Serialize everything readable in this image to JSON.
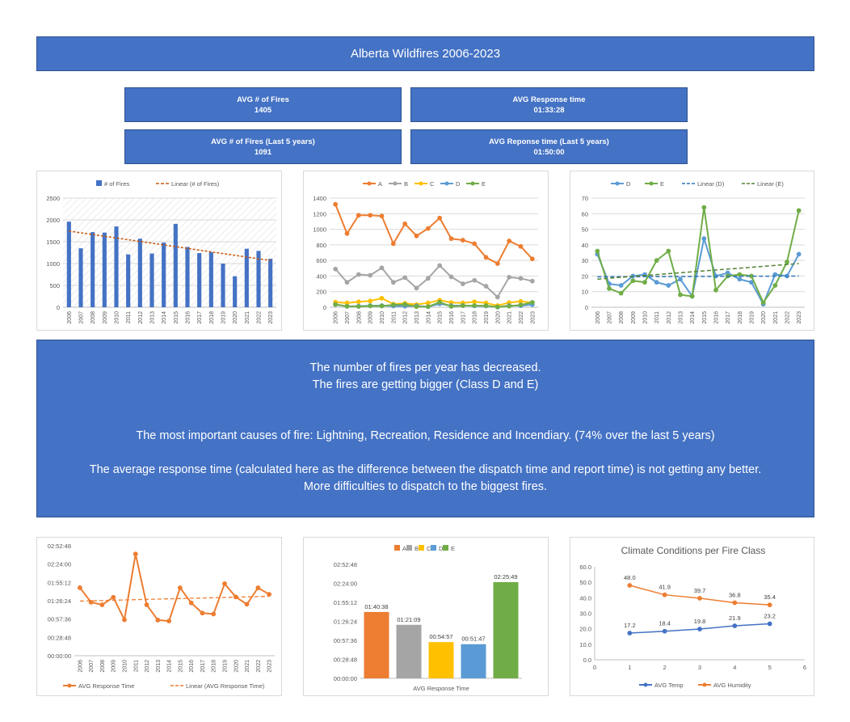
{
  "title": "Alberta Wildfires 2006-2023",
  "kpis": [
    {
      "label": "AVG # of Fires",
      "value": "1405"
    },
    {
      "label": "AVG Response time",
      "value": "01:33:28"
    },
    {
      "label": "AVG # of Fires (Last 5 years)",
      "value": "1091"
    },
    {
      "label": "AVG Reponse time (Last 5 years)",
      "value": "01:50:00"
    }
  ],
  "summary": {
    "line1": "The number of fires per year has decreased.",
    "line2": "The fires are getting bigger (Class D and E)",
    "line3": "The most important causes of fire: Lightning, Recreation, Residence and Incendiary. (74% over the last 5 years)",
    "line4": "The average response time (calculated here as the difference between the dispatch time and report time) is not getting any better.",
    "line5": "More difficulties to dispatch to the biggest fires."
  },
  "colors": {
    "blue": "#4472C4",
    "orange": "#ED7D31",
    "gray": "#A5A5A5",
    "yellow": "#FFC000",
    "lightblue": "#5B9BD5",
    "green": "#70AD47",
    "darkgreen": "#548235"
  },
  "chart_data": [
    {
      "id": "fires",
      "type": "bar",
      "categories": [
        "2006",
        "2007",
        "2008",
        "2009",
        "2010",
        "2011",
        "2012",
        "2013",
        "2014",
        "2015",
        "2016",
        "2017",
        "2018",
        "2019",
        "2020",
        "2021",
        "2022",
        "2023"
      ],
      "series": [
        {
          "name": "# of Fires",
          "values": [
            1960,
            1350,
            1720,
            1710,
            1850,
            1210,
            1570,
            1230,
            1480,
            1910,
            1380,
            1240,
            1260,
            1000,
            710,
            1340,
            1290,
            1110
          ]
        }
      ],
      "trendline": {
        "name": "Linear (# of Fires)",
        "from": 1745,
        "to": 1070
      },
      "ylim": [
        0,
        2500
      ],
      "yticks": [
        "0",
        "500",
        "1000",
        "1500",
        "2000",
        "2500"
      ],
      "legend": "top"
    },
    {
      "id": "classes",
      "type": "line",
      "categories": [
        "2006",
        "2007",
        "2008",
        "2009",
        "2010",
        "2011",
        "2012",
        "2013",
        "2014",
        "2015",
        "2016",
        "2017",
        "2018",
        "2019",
        "2020",
        "2021",
        "2022",
        "2023"
      ],
      "series": [
        {
          "name": "A",
          "values": [
            1320,
            945,
            1180,
            1180,
            1170,
            815,
            1070,
            915,
            1010,
            1145,
            880,
            860,
            815,
            640,
            560,
            850,
            780,
            620
          ]
        },
        {
          "name": "B",
          "values": [
            490,
            320,
            420,
            410,
            505,
            320,
            380,
            245,
            370,
            535,
            390,
            300,
            345,
            270,
            130,
            385,
            370,
            335
          ]
        },
        {
          "name": "C",
          "values": [
            65,
            55,
            70,
            80,
            115,
            40,
            50,
            35,
            55,
            90,
            60,
            55,
            70,
            55,
            20,
            60,
            75,
            60
          ]
        },
        {
          "name": "D",
          "values": [
            34,
            12,
            14,
            20,
            21,
            16,
            14,
            18,
            7,
            44,
            20,
            22,
            18,
            16,
            2,
            21,
            20,
            34
          ]
        },
        {
          "name": "E",
          "values": [
            36,
            12,
            9,
            17,
            16,
            30,
            36,
            8,
            7,
            64,
            11,
            20,
            21,
            20,
            3,
            14,
            29,
            62
          ]
        }
      ],
      "ylim": [
        0,
        1400
      ],
      "yticks": [
        "0",
        "200",
        "400",
        "600",
        "800",
        "1000",
        "1200",
        "1400"
      ],
      "legend": "top"
    },
    {
      "id": "de",
      "type": "line",
      "categories": [
        "2006",
        "2007",
        "2008",
        "2009",
        "2010",
        "2011",
        "2012",
        "2013",
        "2014",
        "2015",
        "2016",
        "2017",
        "2018",
        "2019",
        "2020",
        "2021",
        "2022",
        "2023"
      ],
      "series": [
        {
          "name": "D",
          "values": [
            34,
            15,
            14,
            20,
            21,
            16,
            14,
            18,
            7,
            44,
            20,
            22,
            18,
            16,
            2,
            21,
            20,
            34
          ]
        },
        {
          "name": "E",
          "values": [
            36,
            12,
            9,
            17,
            16,
            30,
            36,
            8,
            7,
            64,
            11,
            20,
            21,
            20,
            3,
            14,
            29,
            62
          ]
        }
      ],
      "trendlines": [
        {
          "name": "Linear (D)",
          "from": 19.5,
          "to": 20
        },
        {
          "name": "Linear (E)",
          "from": 18,
          "to": 28
        }
      ],
      "ylim": [
        0,
        70
      ],
      "yticks": [
        "0",
        "10",
        "20",
        "30",
        "40",
        "50",
        "60",
        "70"
      ],
      "legend": "top"
    },
    {
      "id": "response",
      "type": "line",
      "categories": [
        "2006",
        "2007",
        "2008",
        "2009",
        "2010",
        "2011",
        "2012",
        "2013",
        "2014",
        "2015",
        "2016",
        "2017",
        "2018",
        "2019",
        "2020",
        "2021",
        "2022",
        "2023"
      ],
      "series": [
        {
          "name": "AVG Response Time",
          "values": [
            6410,
            5040,
            4800,
            5510,
            3390,
            9590,
            4800,
            3360,
            3270,
            6400,
            4980,
            4020,
            3930,
            6790,
            5540,
            4850,
            6400,
            5790
          ]
        }
      ],
      "trendline": {
        "name": "Linear (AVG Response Time)",
        "from": 5150,
        "to": 5600
      },
      "ylim": [
        0,
        10368
      ],
      "yticks": [
        "00:00:00",
        "00:28:48",
        "00:57:36",
        "01:26:24",
        "01:55:12",
        "02:24:00",
        "02:52:48"
      ],
      "legend": "bottom"
    },
    {
      "id": "byclass",
      "type": "bar",
      "categories": [
        "A",
        "B",
        "C",
        "D",
        "E"
      ],
      "values": [
        6038,
        4869,
        3297,
        3107,
        8749
      ],
      "data_labels": [
        "01:40:38",
        "01:21:09",
        "00:54:57",
        "00:51:47",
        "02:25:49"
      ],
      "xlabel": "AVG Response Time",
      "ylim": [
        0,
        10368
      ],
      "yticks": [
        "00:00:00",
        "00:28:48",
        "00:57:36",
        "01:26:24",
        "01:55:12",
        "02:24:00",
        "02:52:48"
      ],
      "legend": "top"
    },
    {
      "id": "climate",
      "type": "scatter",
      "title": "Climate Conditions per Fire Class",
      "series": [
        {
          "name": "AVG Temp",
          "x": [
            1,
            2,
            3,
            4,
            5
          ],
          "values": [
            17.2,
            18.4,
            19.8,
            21.9,
            23.2
          ],
          "labels": [
            "17.2",
            "18.4",
            "19.8",
            "21.9",
            "23.2"
          ]
        },
        {
          "name": "AVG Humidity",
          "x": [
            1,
            2,
            3,
            4,
            5
          ],
          "values": [
            48.0,
            41.9,
            39.7,
            36.8,
            35.4
          ],
          "labels": [
            "48.0",
            "41.9",
            "39.7",
            "36.8",
            "35.4"
          ]
        }
      ],
      "xlim": [
        0,
        6
      ],
      "xticks": [
        "0",
        "1",
        "2",
        "3",
        "4",
        "5",
        "6"
      ],
      "ylim": [
        0,
        60
      ],
      "yticks": [
        "0.0",
        "10.0",
        "20.0",
        "30.0",
        "40.0",
        "50.0",
        "60.0"
      ],
      "legend": "bottom"
    }
  ]
}
